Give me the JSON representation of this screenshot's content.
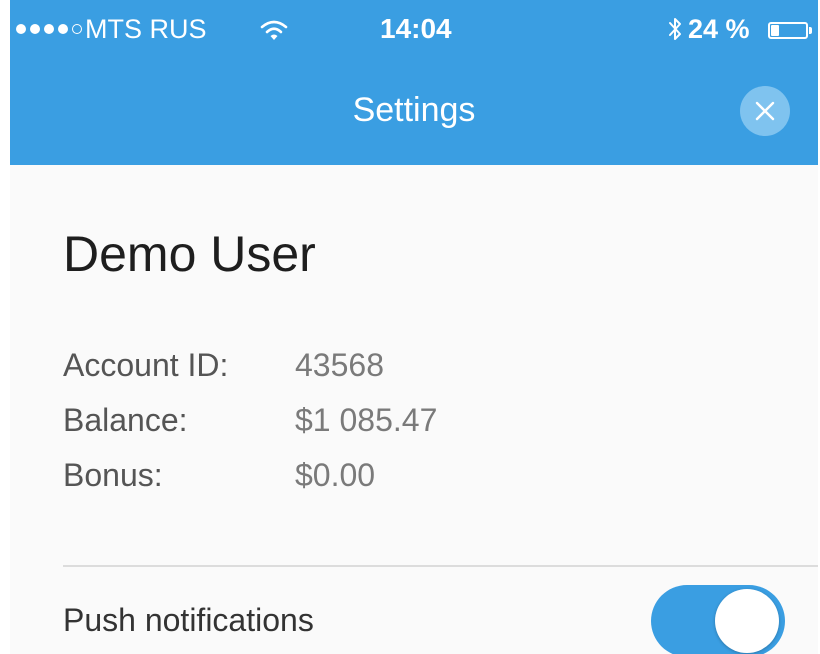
{
  "status_bar": {
    "signal_filled": 4,
    "signal_total": 5,
    "carrier": "MTS RUS",
    "wifi_icon": "wifi-icon",
    "time": "14:04",
    "bluetooth_icon": "bluetooth-icon",
    "battery_percent_label": "24 %",
    "battery_level": 0.24,
    "battery_icon": "battery-icon"
  },
  "nav": {
    "title": "Settings",
    "close_icon": "close-icon"
  },
  "profile": {
    "name": "Demo User",
    "account_id_label": "Account ID:",
    "account_id_value": "43568",
    "balance_label": "Balance:",
    "balance_value": "$1 085.47",
    "bonus_label": "Bonus:",
    "bonus_value": "$0.00"
  },
  "settings": {
    "push_notifications_label": "Push notifications",
    "push_notifications_enabled": true
  },
  "colors": {
    "accent": "#3a9ee2",
    "close_button_bg": "#7fc3ef",
    "background": "#fafafa",
    "divider": "#dcdcdc"
  }
}
